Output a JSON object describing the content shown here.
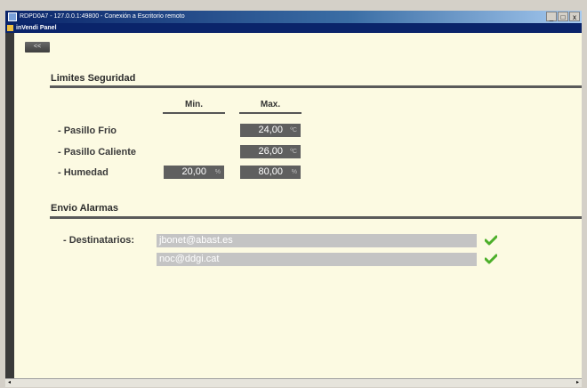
{
  "window": {
    "title": "RDPD0A7 - 127.0.0.1:49800 - Conexión a Escritorio remoto",
    "app_title": "inVendi Panel",
    "controls": [
      "_",
      "□",
      "x"
    ]
  },
  "panel": {
    "back_label": "<<",
    "security": {
      "title": "Limites Seguridad",
      "col_min": "Min.",
      "col_max": "Max.",
      "rows": [
        {
          "label": "- Pasillo Frio",
          "max": "24,00",
          "max_unit": "ºC"
        },
        {
          "label": "- Pasillo Caliente",
          "max": "26,00",
          "max_unit": "ºC"
        },
        {
          "label": "- Humedad",
          "min": "20,00",
          "min_unit": "%",
          "max": "80,00",
          "max_unit": "%"
        }
      ]
    },
    "alarms": {
      "title": "Envio Alarmas",
      "recipients_label": "- Destinatarios:",
      "recipients": [
        "jbonet@abast.es",
        "noc@ddgi.cat"
      ]
    }
  },
  "colors": {
    "panel_bg": "#fcfae2",
    "value_box": "#5f5f5f",
    "email_field": "#c4c4c4",
    "check": "#4caf2a"
  },
  "icons": {
    "window": "window-icon",
    "app": "app-icon",
    "valid": "check-icon"
  }
}
